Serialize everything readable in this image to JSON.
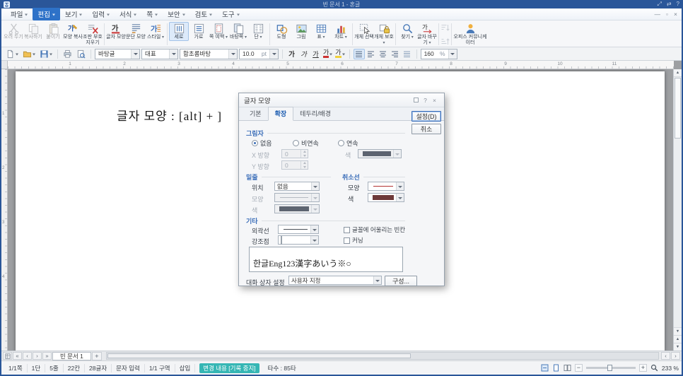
{
  "titlebar": {
    "title": "빈 문서 1 - 혼글",
    "controls": {
      "fullscreen": "⤢",
      "switch": "⇄",
      "help": "?"
    }
  },
  "menubar": {
    "items": [
      {
        "label": "파일"
      },
      {
        "label": "편집"
      },
      {
        "label": "보기"
      },
      {
        "label": "입력"
      },
      {
        "label": "서식"
      },
      {
        "label": "쪽"
      },
      {
        "label": "보안"
      },
      {
        "label": "검토"
      },
      {
        "label": "도구"
      }
    ],
    "active_item": "편집",
    "window_controls": {
      "minimize": "—",
      "restore": "▫",
      "close": "×"
    }
  },
  "ribbon": {
    "items": [
      {
        "label": "오려 두기"
      },
      {
        "label": "복사하기"
      },
      {
        "label": "붙이기"
      },
      {
        "label": "모양 복사"
      },
      {
        "label": "조판 부호 지우기"
      },
      {
        "label": "글자 모양"
      },
      {
        "label": "문단 모양"
      },
      {
        "label": "스타일"
      },
      {
        "label": "세로"
      },
      {
        "label": "가로"
      },
      {
        "label": "쪽 여백"
      },
      {
        "label": "바탕쪽"
      },
      {
        "label": "단"
      },
      {
        "label": "도형"
      },
      {
        "label": "그림"
      },
      {
        "label": "표"
      },
      {
        "label": "차트"
      },
      {
        "label": "개체 선택"
      },
      {
        "label": "개체 보호"
      },
      {
        "label": "찾기"
      },
      {
        "label": "글자 바꾸기"
      },
      {
        "label": "오피스 커뮤니케이터"
      }
    ]
  },
  "format_toolbar": {
    "style": "바탕글",
    "preset": "대표",
    "font": "함초롬바탕",
    "size": "10.0",
    "size_unit": "pt",
    "bold": "가",
    "italic": "가",
    "underline": "가",
    "char_color": "가",
    "highlight": "가",
    "line_spacing": "160",
    "line_spacing_unit": "%"
  },
  "ruler": {
    "h_numbers": [
      "1",
      "2",
      "3",
      "4",
      "5",
      "6",
      "7",
      "8",
      "9",
      "10",
      "11"
    ],
    "v_numbers": [
      "1",
      "2",
      "3",
      "4"
    ]
  },
  "document": {
    "text": "글자 모양 : [alt] + ]"
  },
  "dialog": {
    "title": "글자 모양",
    "tabs": [
      "기본",
      "확장",
      "테두리/배경"
    ],
    "ok": "설정(D)",
    "cancel": "취소",
    "controls": {
      "help": "?",
      "close": "×"
    },
    "shadow": {
      "title": "그림자",
      "options": [
        "없음",
        "비연속",
        "연속"
      ],
      "selected": "없음",
      "x_label": "X 방향",
      "x_value": "0",
      "y_label": "Y 방향",
      "y_value": "0",
      "color_label": "색"
    },
    "underline": {
      "title": "밑줄",
      "position_label": "위치",
      "position_value": "없음",
      "shape_label": "모양",
      "color_label": "색"
    },
    "strikeout": {
      "title": "취소선",
      "shape_label": "모양",
      "color_label": "색"
    },
    "etc": {
      "title": "기타",
      "outline_label": "외곽선",
      "accent_label": "강조점",
      "checkbox1": "글꼴에 어울리는 빈칸",
      "checkbox2": "커닝"
    },
    "preview_text": "한글Eng123漢字あいう※○",
    "settings_label": "대화 상자 설정",
    "settings_value": "사용자 지정",
    "configure_button": "구성..."
  },
  "doc_tabs": {
    "active": "빈 문서 1",
    "add": "+"
  },
  "statusbar": {
    "left": [
      "1/1쪽",
      "1단",
      "5줄",
      "22칸",
      "28글자",
      "문자 입력",
      "1/1 구역",
      "삽입"
    ],
    "record": "변경 내용 [기록 중지]",
    "keystrokes": "타수 : 85타",
    "zoom": "233 %"
  }
}
